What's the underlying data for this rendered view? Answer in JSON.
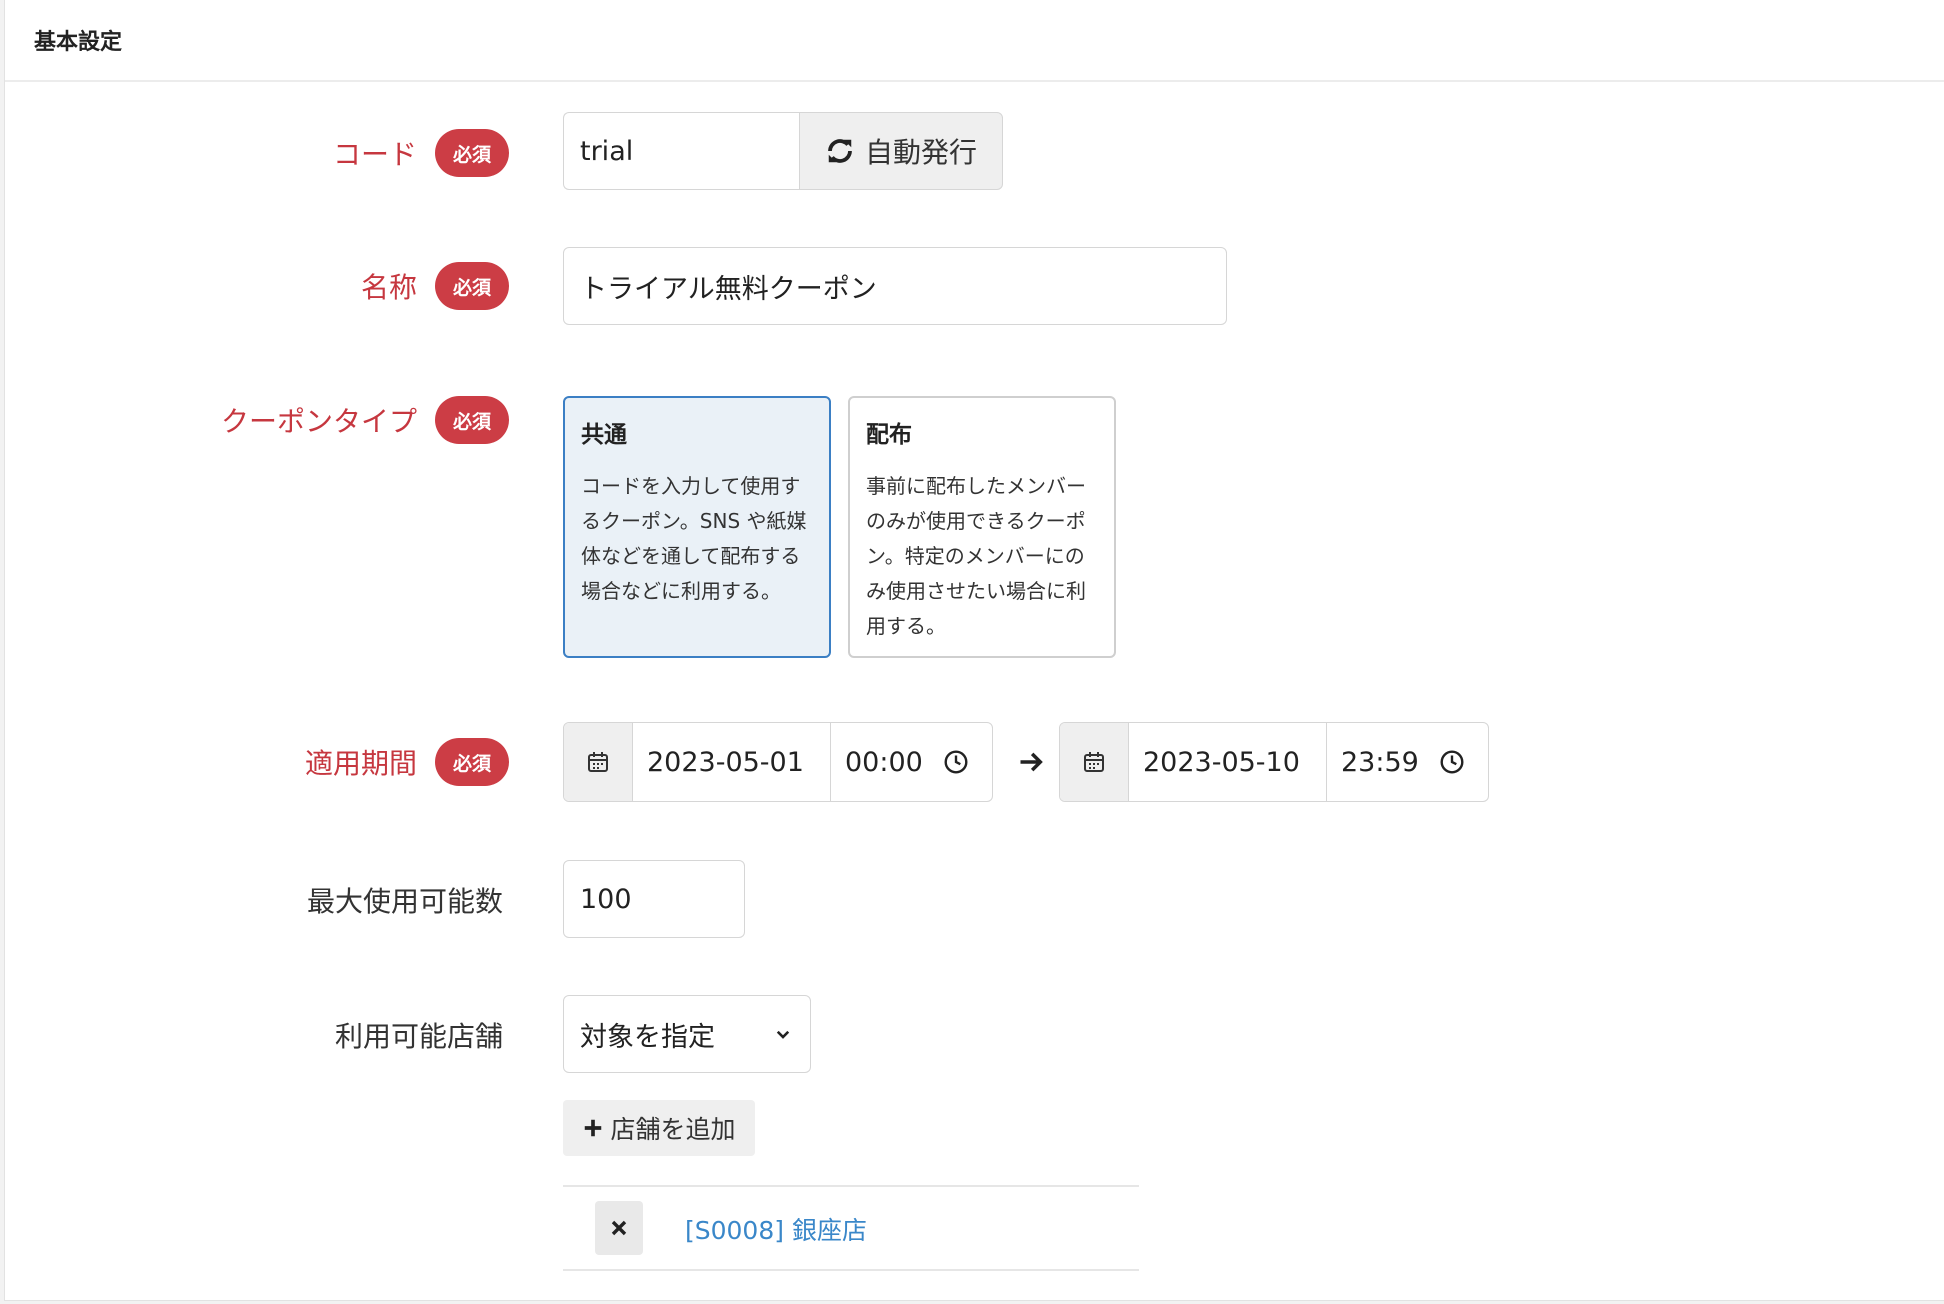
{
  "section": {
    "title": "基本設定"
  },
  "required_badge": "必須",
  "code": {
    "label": "コード",
    "value": "trial",
    "auto_button": "自動発行",
    "icon": "refresh-icon"
  },
  "name": {
    "label": "名称",
    "value": "トライアル無料クーポン"
  },
  "coupon_type": {
    "label": "クーポンタイプ",
    "options": [
      {
        "title": "共通",
        "description": "コードを入力して使用するクーポン。SNS や紙媒体などを通して配布する場合などに利用する。",
        "selected": true
      },
      {
        "title": "配布",
        "description": "事前に配布したメンバーのみが使用できるクーポン。特定のメンバーにのみ使用させたい場合に利用する。",
        "selected": false
      }
    ]
  },
  "period": {
    "label": "適用期間",
    "start_date": "2023-05-01",
    "start_time": "00:00",
    "end_date": "2023-05-10",
    "end_time": "23:59"
  },
  "max_usage": {
    "label": "最大使用可能数",
    "value": "100"
  },
  "stores": {
    "label": "利用可能店舗",
    "select_value": "対象を指定",
    "add_button": "店舗を追加",
    "items": [
      {
        "name": "[S0008] 銀座店"
      }
    ]
  },
  "colors": {
    "required": "#c6373f",
    "badge": "#cc3d45",
    "accent": "#3b7fc4",
    "link": "#3a87c9"
  }
}
